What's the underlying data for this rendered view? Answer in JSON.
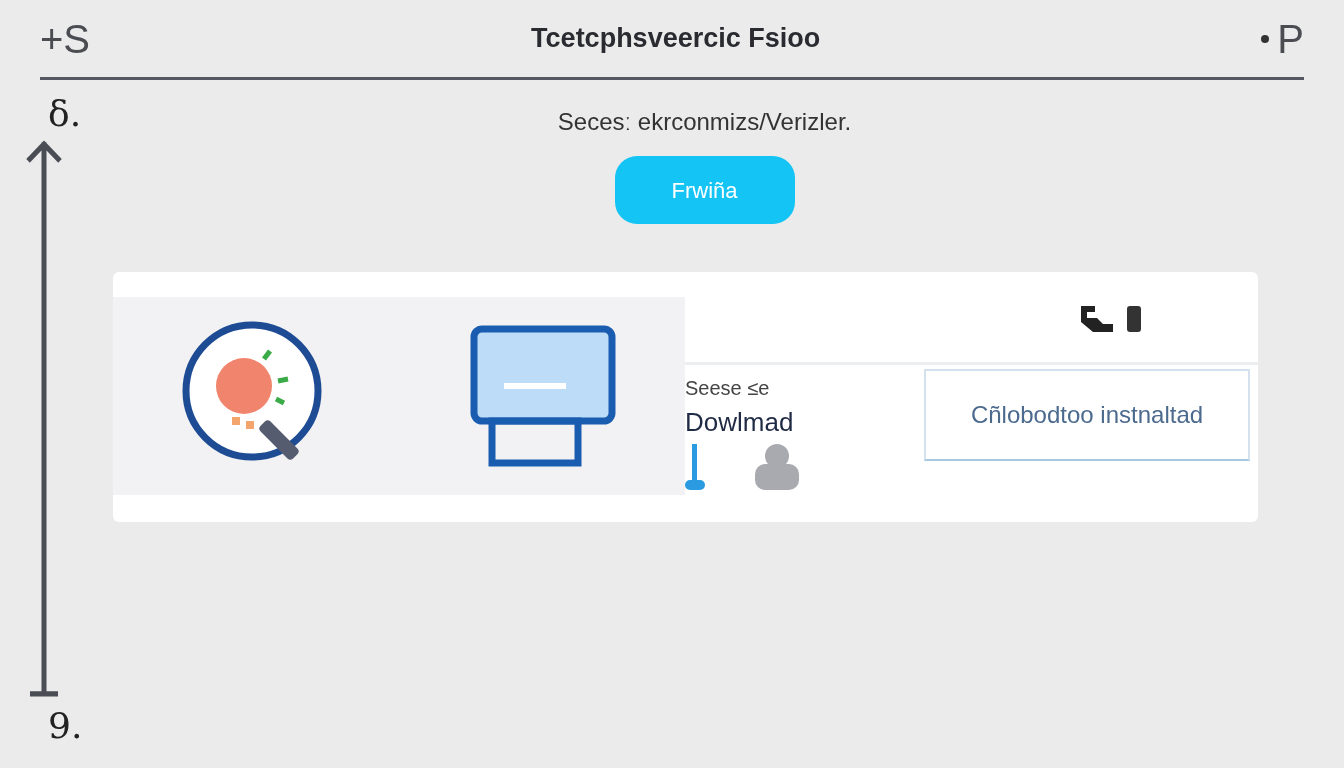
{
  "header": {
    "left_label": "+S",
    "title": "Tcetcphsveercic Fsioo",
    "right_label": "P"
  },
  "axis": {
    "top_label": "δ.",
    "bottom_label": "9."
  },
  "subtitle": "Secesː ekrconmizs/Verizler.",
  "button": {
    "label": "Frwiña"
  },
  "card": {
    "caption": "Seese ≤e",
    "heading": "Dowlmad",
    "status_box": "Cñlobodtoo instnaltad"
  }
}
